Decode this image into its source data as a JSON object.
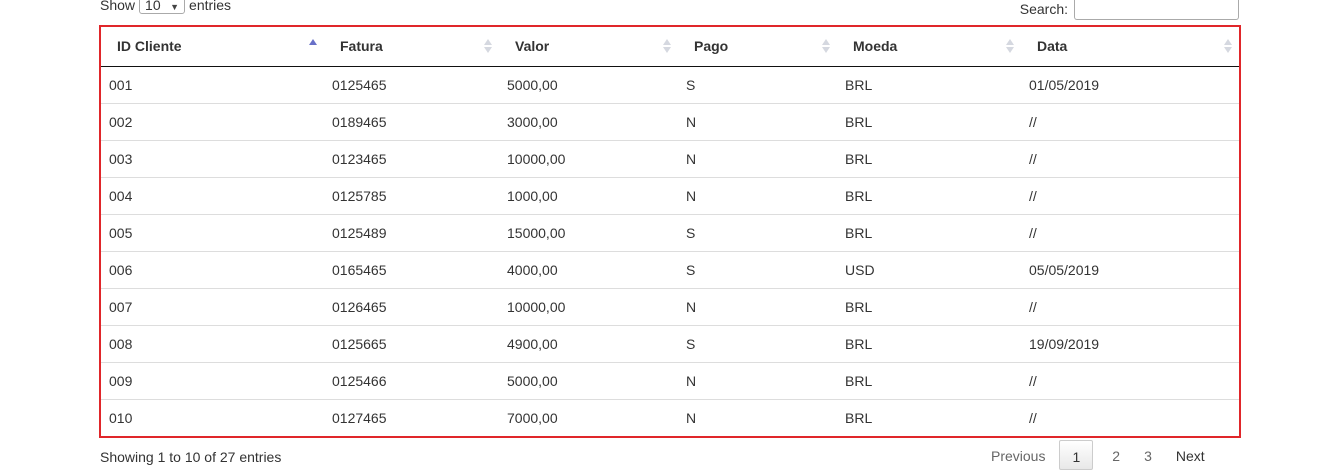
{
  "length_control": {
    "prefix": "Show",
    "selected": "10",
    "suffix": "entries"
  },
  "search": {
    "label": "Search:",
    "value": ""
  },
  "table": {
    "columns": [
      {
        "label": "ID Cliente",
        "sort": "asc"
      },
      {
        "label": "Fatura",
        "sort": "none"
      },
      {
        "label": "Valor",
        "sort": "none"
      },
      {
        "label": "Pago",
        "sort": "none"
      },
      {
        "label": "Moeda",
        "sort": "none"
      },
      {
        "label": "Data",
        "sort": "none"
      }
    ],
    "rows": [
      [
        "001",
        "0125465",
        "5000,00",
        "S",
        "BRL",
        "01/05/2019"
      ],
      [
        "002",
        "0189465",
        "3000,00",
        "N",
        "BRL",
        "//"
      ],
      [
        "003",
        "0123465",
        "10000,00",
        "N",
        "BRL",
        "//"
      ],
      [
        "004",
        "0125785",
        "1000,00",
        "N",
        "BRL",
        "//"
      ],
      [
        "005",
        "0125489",
        "15000,00",
        "S",
        "BRL",
        "//"
      ],
      [
        "006",
        "0165465",
        "4000,00",
        "S",
        "USD",
        "05/05/2019"
      ],
      [
        "007",
        "0126465",
        "10000,00",
        "N",
        "BRL",
        "//"
      ],
      [
        "008",
        "0125665",
        "4900,00",
        "S",
        "BRL",
        "19/09/2019"
      ],
      [
        "009",
        "0125466",
        "5000,00",
        "N",
        "BRL",
        "//"
      ],
      [
        "010",
        "0127465",
        "7000,00",
        "N",
        "BRL",
        "//"
      ]
    ]
  },
  "info": "Showing 1 to 10 of 27 entries",
  "pagination": {
    "previous": "Previous",
    "pages": [
      "1",
      "2",
      "3"
    ],
    "current": "1",
    "next": "Next"
  },
  "colors": {
    "highlight_border": "#e0262a",
    "sort_active": "#6870c8",
    "sort_inactive": "#d5d8e0"
  }
}
